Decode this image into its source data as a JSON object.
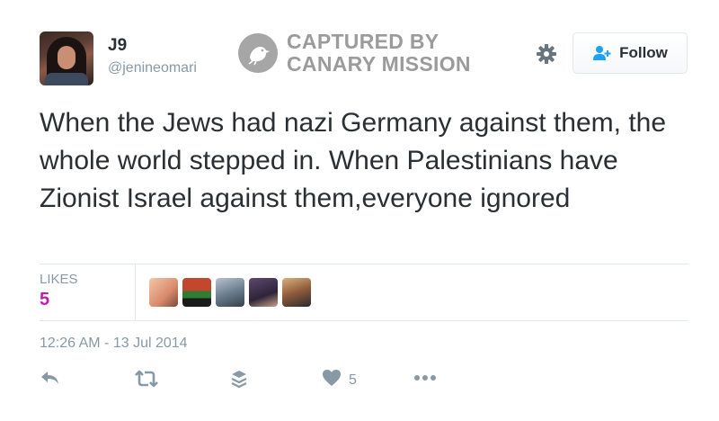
{
  "user": {
    "name": "J9",
    "handle": "@jenineomari"
  },
  "watermark": {
    "line1": "CAPTURED BY",
    "line2": "CANARY MISSION"
  },
  "follow_button": {
    "label": "Follow",
    "icon": "add-user-icon"
  },
  "tweet": {
    "text": "When the Jews had nazi Germany against them, the whole world stepped in. When Palestinians have Zionist Israel against them,everyone ignored"
  },
  "stats": {
    "likes_label": "LIKES",
    "likes_count": "5"
  },
  "timestamp": "12:26 AM - 13 Jul 2014",
  "actions": {
    "reply_icon": "reply-icon",
    "retweet_icon": "retweet-icon",
    "stack_icon": "layers-icon",
    "like_icon": "heart-icon",
    "like_count": "5",
    "more_icon": "more-icon"
  },
  "colors": {
    "likes_accent": "#c41bb5",
    "muted": "#8899a6",
    "text": "#292f33",
    "watermark": "#9b9b9b"
  }
}
